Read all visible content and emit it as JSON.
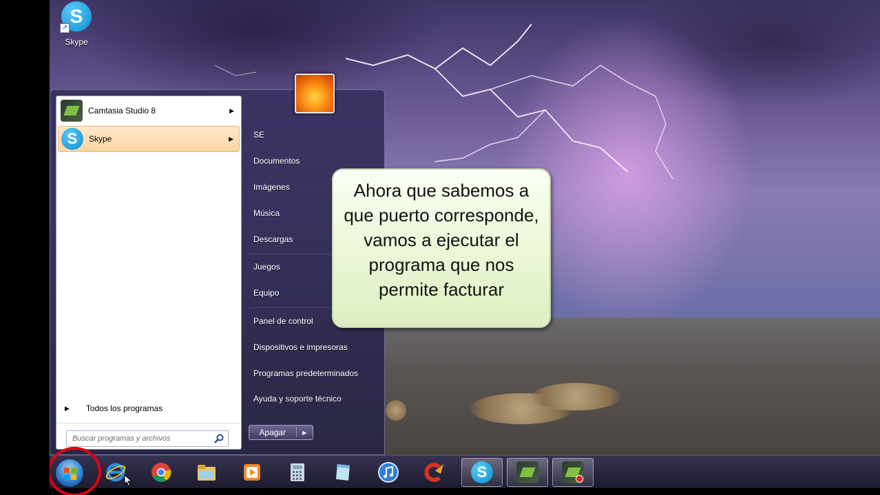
{
  "desktop": {
    "icons": [
      {
        "label": "Skype",
        "icon": "skype-icon"
      }
    ]
  },
  "start_menu": {
    "pinned_programs": [
      {
        "label": "Camtasia Studio 8",
        "icon": "camtasia-icon",
        "has_submenu": true,
        "selected": false
      },
      {
        "label": "Skype",
        "icon": "skype-icon",
        "has_submenu": true,
        "selected": true
      }
    ],
    "all_programs_label": "Todos los programas",
    "search_placeholder": "Buscar programas y archivos",
    "right_links": [
      "SE",
      "Documentos",
      "Imágenes",
      "Música",
      "Descargas",
      "Juegos",
      "Equipo",
      "Panel de control",
      "Dispositivos e impresoras",
      "Programas predeterminados",
      "Ayuda y soporte técnico"
    ],
    "shutdown_label": "Apagar"
  },
  "callout": {
    "text": "Ahora que sabemos a que puerto corresponde, vamos a ejecutar el programa que nos permite facturar"
  },
  "taskbar": {
    "start_button": "windows-start-orb",
    "items": [
      {
        "icon": "internet-explorer-icon",
        "active": false
      },
      {
        "icon": "chrome-icon",
        "active": false
      },
      {
        "icon": "file-explorer-icon",
        "active": false
      },
      {
        "icon": "media-player-icon",
        "active": false
      },
      {
        "icon": "calculator-icon",
        "active": false
      },
      {
        "icon": "notepad-icon",
        "active": false
      },
      {
        "icon": "itunes-icon",
        "active": false
      },
      {
        "icon": "ccleaner-icon",
        "active": false
      },
      {
        "icon": "skype-icon",
        "active": true
      },
      {
        "icon": "camtasia-icon",
        "active": true
      },
      {
        "icon": "camtasia-recorder-icon",
        "active": true
      }
    ]
  },
  "colors": {
    "highlight_ring": "#e00012",
    "selected_item_bg": "#fbd5a3",
    "callout_bg": "#ecf7d8"
  }
}
